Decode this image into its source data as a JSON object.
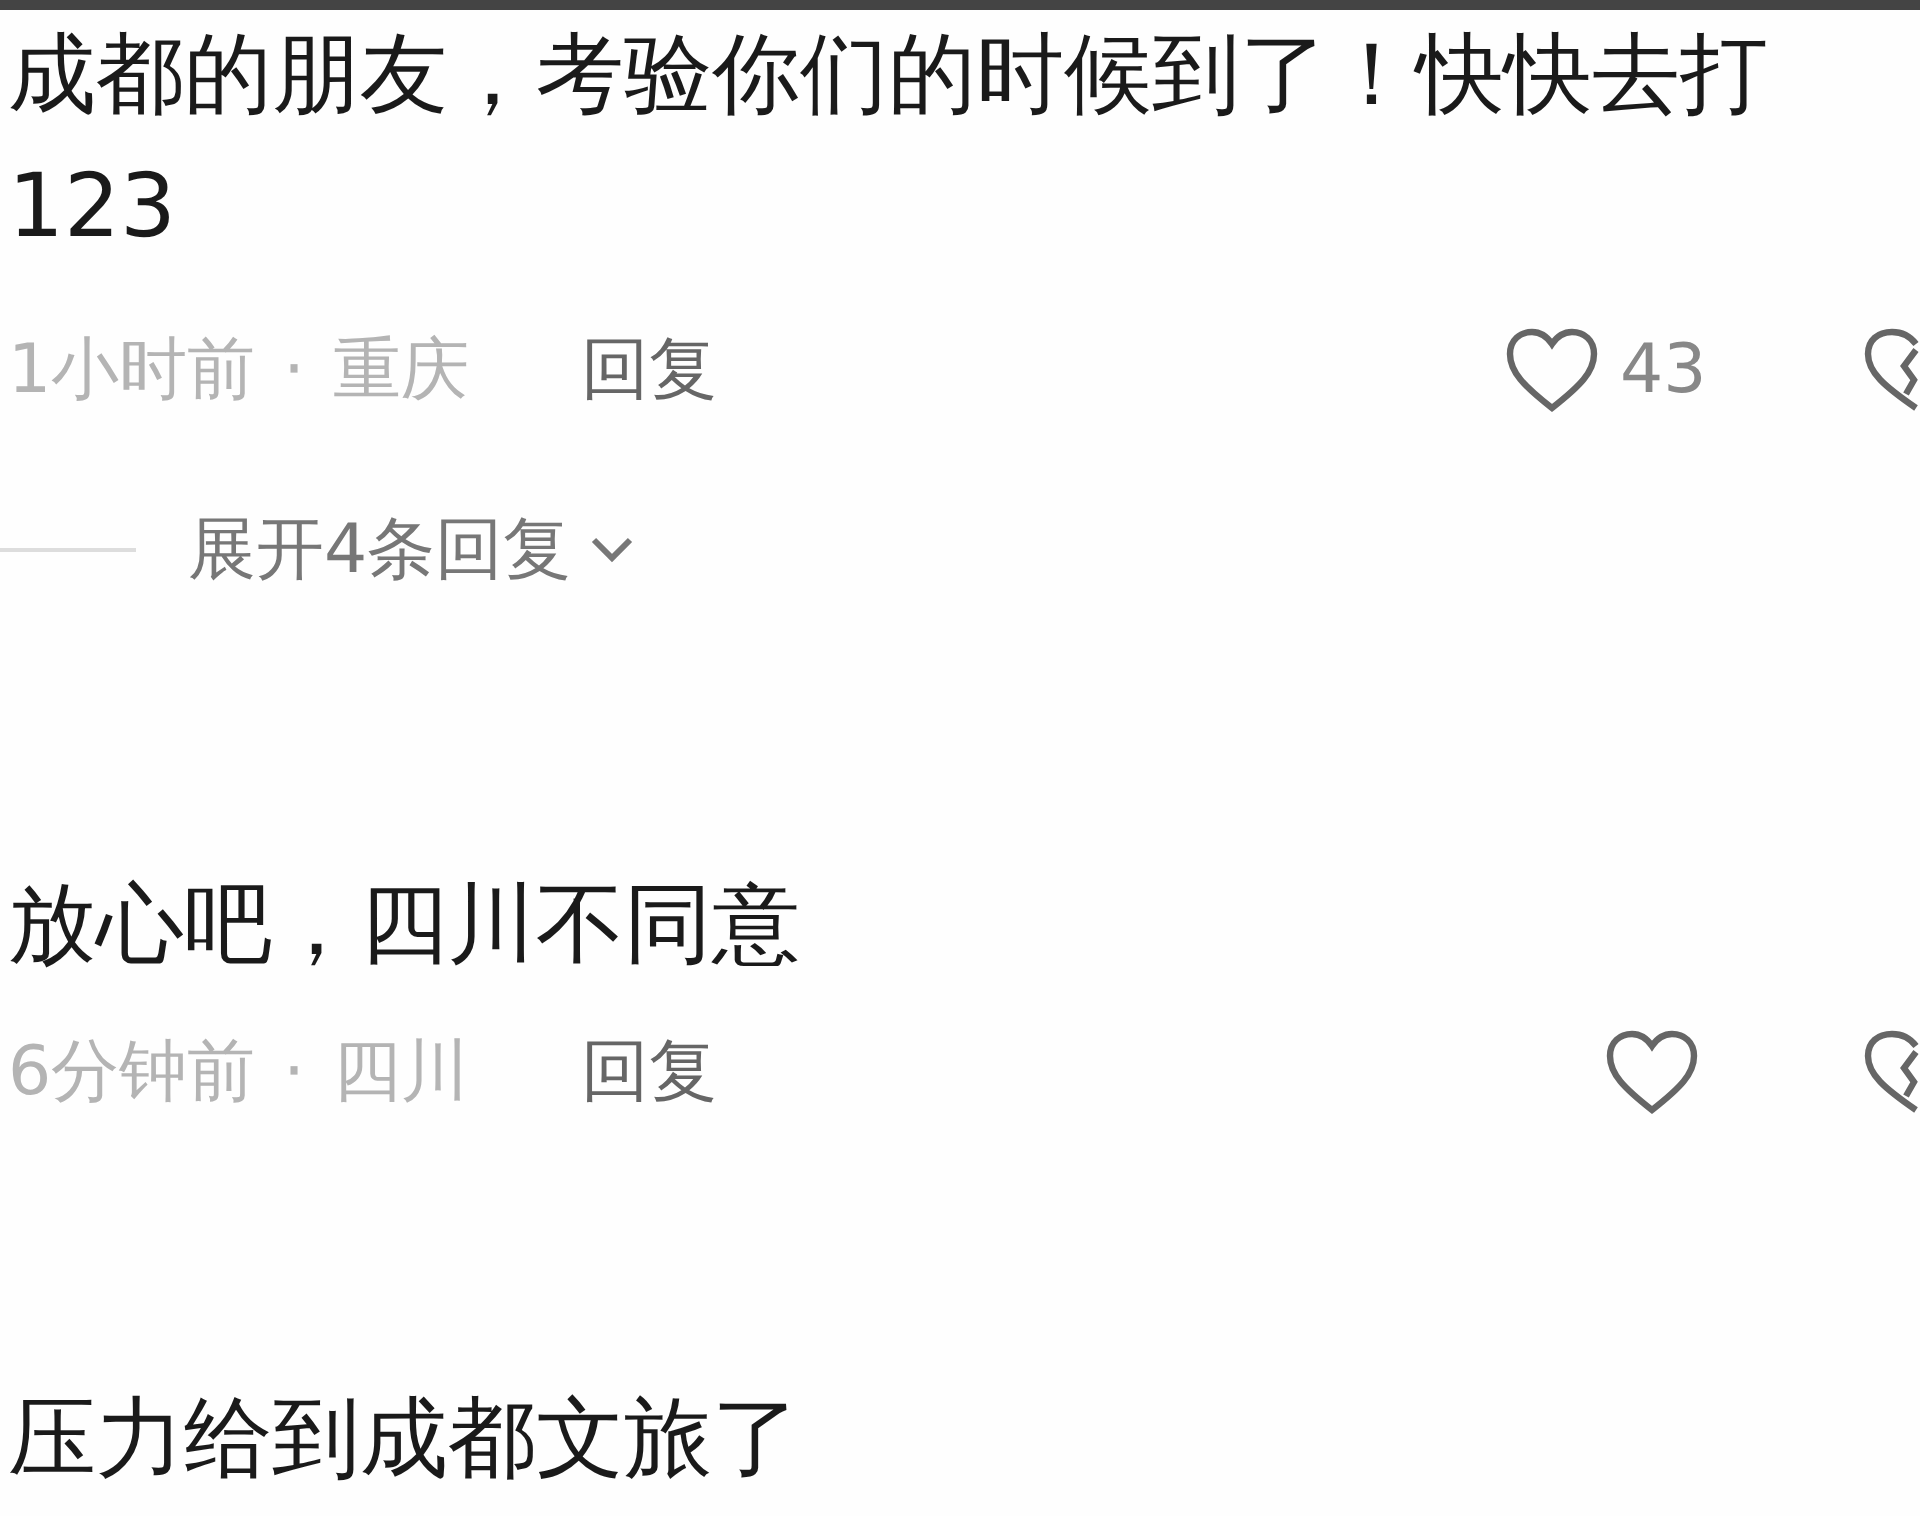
{
  "comments": [
    {
      "lines": [
        "成都的朋友，考验你们的时候到了！快快去打",
        "123"
      ],
      "time": "1小时前",
      "separator": "·",
      "location": "重庆",
      "reply": "回复",
      "likes": "43",
      "expand": "展开4条回复"
    },
    {
      "lines": [
        "放心吧，四川不同意"
      ],
      "time": "6分钟前",
      "separator": "·",
      "location": "四川",
      "reply": "回复"
    },
    {
      "lines": [
        "压力给到成都文旅了"
      ]
    }
  ]
}
